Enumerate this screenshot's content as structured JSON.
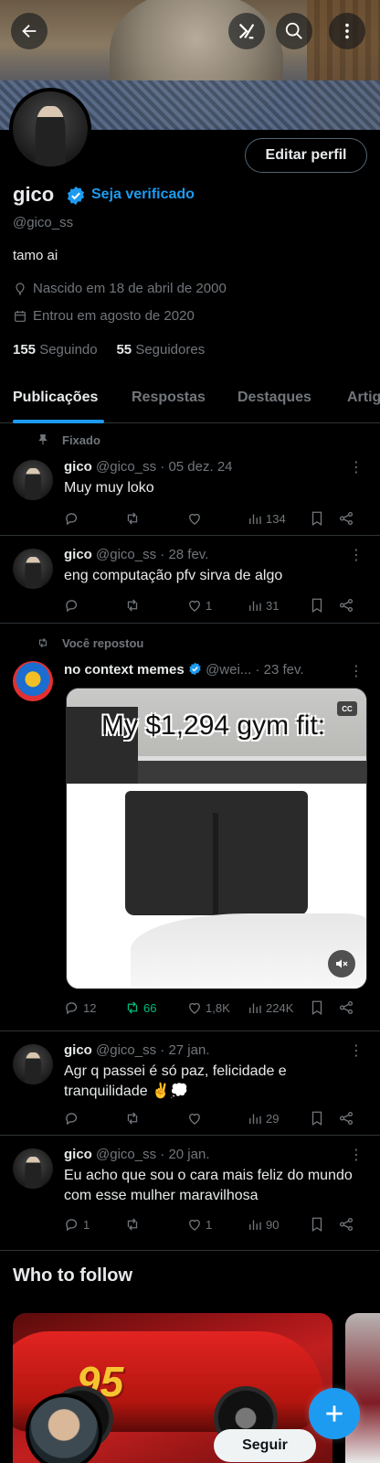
{
  "header": {
    "back_label": "Voltar",
    "grok_label": "Grok",
    "search_label": "Pesquisar",
    "more_label": "Mais"
  },
  "profile": {
    "name": "gico",
    "verify_link": "Seja verificado",
    "handle": "@gico_ss",
    "bio": "tamo ai",
    "birth": "Nascido em 18 de abril de 2000",
    "joined": "Entrou em agosto de 2020",
    "following_count": "155",
    "following_label": "Seguindo",
    "followers_count": "55",
    "followers_label": "Seguidores",
    "edit_button": "Editar perfil"
  },
  "tabs": [
    "Publicações",
    "Respostas",
    "Destaques",
    "Artigos"
  ],
  "posts": [
    {
      "context": "Fixado",
      "author": "gico",
      "handle": "@gico_ss",
      "date": "· 05 dez. 24",
      "text": "Muy muy loko",
      "replies": "",
      "reposts": "",
      "likes": "",
      "views": "134"
    },
    {
      "author": "gico",
      "handle": "@gico_ss",
      "date": "· 28 fev.",
      "text": "eng computação pfv sirva de algo",
      "replies": "",
      "reposts": "",
      "likes": "1",
      "views": "31"
    },
    {
      "context": "Você repostou",
      "author": "no context memes",
      "handle": "@wei...",
      "date": "· 23 fev.",
      "media_caption": "My $1,294 gym fit:",
      "media_cc": "CC",
      "replies": "12",
      "reposts": "66",
      "likes": "1,8K",
      "views": "224K"
    },
    {
      "author": "gico",
      "handle": "@gico_ss",
      "date": "· 27 jan.",
      "text": "Agr q passei é só paz, felicidade e tranquilidade ✌️💭",
      "replies": "",
      "reposts": "",
      "likes": "",
      "views": "29"
    },
    {
      "author": "gico",
      "handle": "@gico_ss",
      "date": "· 20 jan.",
      "text": "Eu acho que sou o cara mais feliz do mundo com esse mulher maravilhosa",
      "replies": "1",
      "reposts": "",
      "likes": "1",
      "views": "90"
    }
  ],
  "who_to_follow": {
    "title": "Who to follow",
    "follow_button": "Seguir",
    "card_number": "95"
  },
  "colors": {
    "accent": "#1d9bf0",
    "repost_green": "#00ba7c",
    "background": "#000000",
    "muted": "#71767b"
  }
}
